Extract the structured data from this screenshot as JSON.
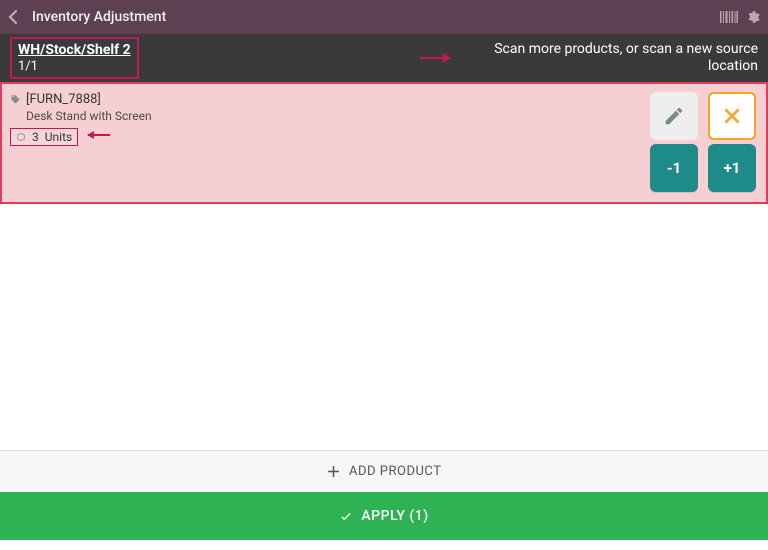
{
  "header": {
    "title": "Inventory Adjustment"
  },
  "subbar": {
    "location": "WH/Stock/Shelf 2",
    "progress": "1/1",
    "hint": "Scan more products, or scan a new source location"
  },
  "item": {
    "sku": "[FURN_7888]",
    "name": "Desk Stand with Screen",
    "qty": "3",
    "uom": "Units",
    "decrement_label": "-1",
    "increment_label": "+1"
  },
  "footer": {
    "add_product_label": "ADD PRODUCT",
    "apply_label": "APPLY (1)"
  }
}
